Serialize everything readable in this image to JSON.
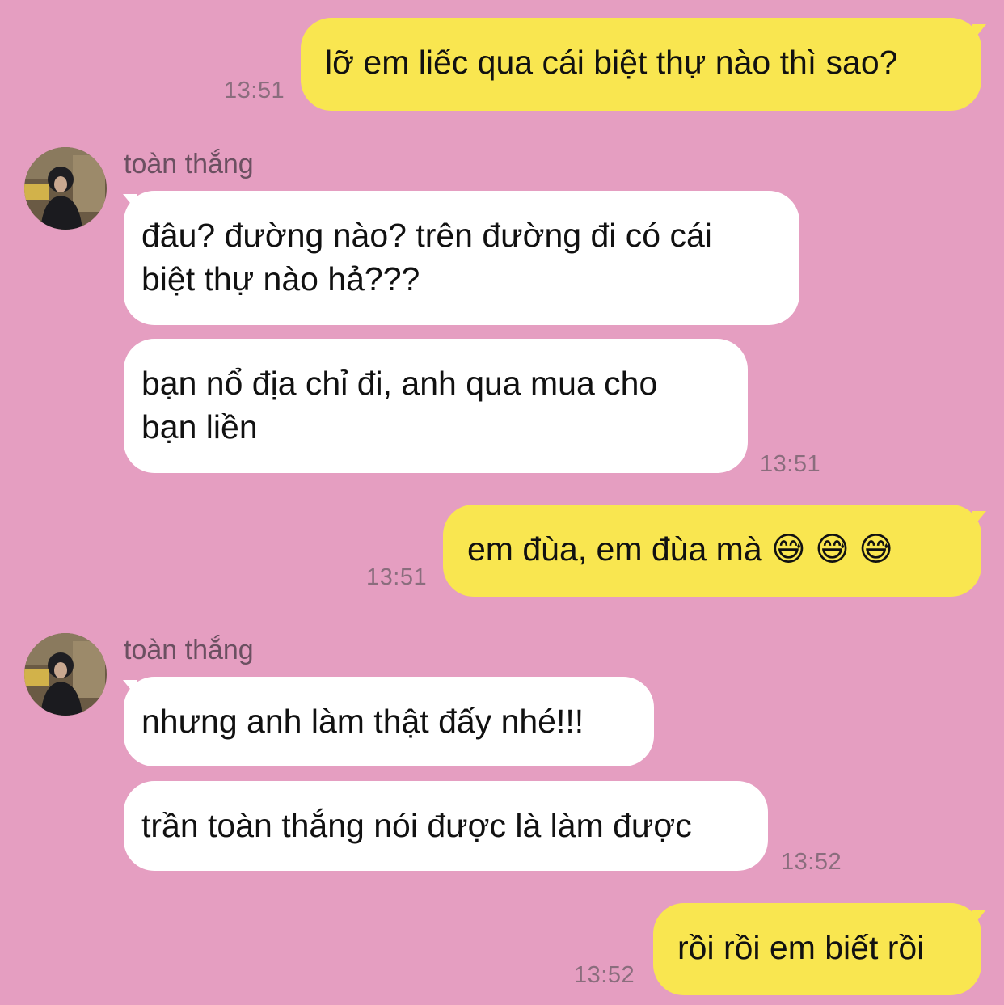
{
  "contact": {
    "name": "toàn thắng"
  },
  "messages": [
    {
      "dir": "out",
      "text": "lỡ em liếc qua cái biệt thự nào thì sao?",
      "time": "13:51"
    },
    {
      "dir": "in",
      "text": "đâu? đường nào? trên đường đi có cái\nbiệt thự nào hả???"
    },
    {
      "dir": "in",
      "text": "bạn nổ địa chỉ đi, anh qua mua cho\nbạn liền",
      "time": "13:51"
    },
    {
      "dir": "out",
      "text": "em đùa, em đùa mà 😅 😅 😅",
      "time": "13:51"
    },
    {
      "dir": "in",
      "text": "nhưng anh làm thật đấy nhé!!!"
    },
    {
      "dir": "in",
      "text": "trần toàn thắng nói được là làm được",
      "time": "13:52"
    },
    {
      "dir": "out",
      "text": "rồi rồi em biết rồi",
      "time": "13:52"
    }
  ],
  "colors": {
    "background": "#e59ec1",
    "outgoing_bubble": "#f9e650",
    "incoming_bubble": "#ffffff"
  }
}
